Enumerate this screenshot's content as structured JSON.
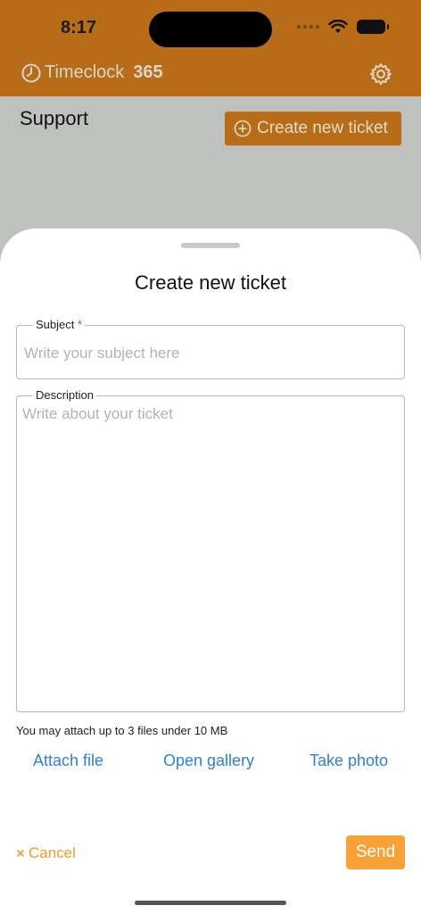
{
  "status_bar": {
    "time": "8:17"
  },
  "header": {
    "brand_name": "Timeclock",
    "brand_number": "365"
  },
  "page": {
    "title": "Support",
    "create_button_label": "Create new ticket"
  },
  "sheet": {
    "title": "Create new ticket",
    "subject": {
      "label": "Subject",
      "required_mark": "*",
      "placeholder": "Write your subject here"
    },
    "description": {
      "label": "Description",
      "placeholder": "Write about your ticket"
    },
    "attach_note": "You may attach up to 3 files under 10 MB",
    "actions": {
      "attach_file": "Attach file",
      "open_gallery": "Open gallery",
      "take_photo": "Take photo"
    },
    "cancel_label": "Cancel",
    "send_label": "Send"
  },
  "colors": {
    "brand_orange": "#b86c17",
    "accent_orange": "#f7a136",
    "link_blue": "#2f80d8"
  }
}
